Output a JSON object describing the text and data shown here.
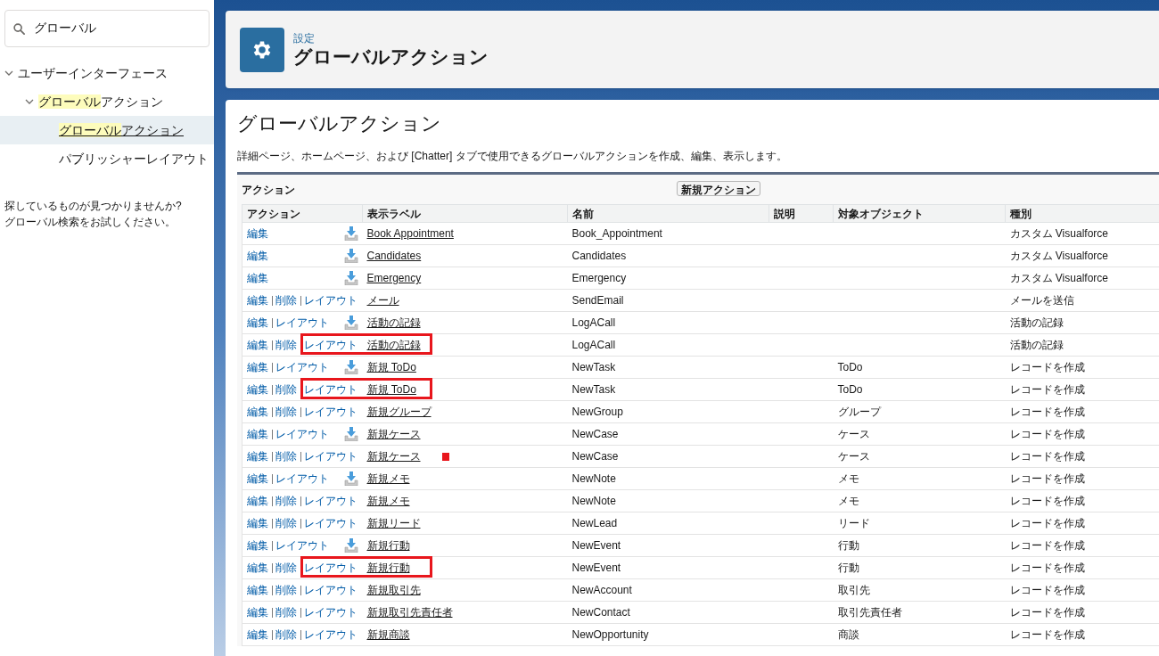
{
  "sidebar": {
    "search": {
      "value": "グローバル"
    },
    "tree": [
      {
        "label_parts": [
          {
            "text": "ユーザーインターフェース",
            "highlighted": false
          }
        ],
        "expanded": true,
        "selected": false,
        "children": [
          {
            "label_parts": [
              {
                "text": "グローバル",
                "highlighted": true
              },
              {
                "text": "アクション",
                "highlighted": false
              }
            ],
            "expanded": true,
            "selected": false,
            "children": [
              {
                "label_parts": [
                  {
                    "text": "グローバル",
                    "highlighted": true
                  },
                  {
                    "text": "アクション",
                    "highlighted": false
                  }
                ],
                "selected": true
              },
              {
                "label_parts": [
                  {
                    "text": "パブリッシャーレイアウト",
                    "highlighted": false
                  }
                ],
                "selected": false
              }
            ]
          }
        ]
      }
    ],
    "hint": [
      "探しているものが見つかりませんか?",
      "グローバル検索をお試しください。"
    ]
  },
  "header": {
    "breadcrumb": "設定",
    "title": "グローバルアクション"
  },
  "page": {
    "title": "グローバルアクション",
    "description": "詳細ページ、ホームページ、および [Chatter] タブで使用できるグローバルアクションを作成、編集、表示します。",
    "section": {
      "title": "アクション",
      "button": "新規アクション"
    },
    "table": {
      "columns": [
        "アクション",
        "表示ラベル",
        "名前",
        "説明",
        "対象オブジェクト",
        "種別"
      ],
      "rows": [
        {
          "actions": [
            "編集"
          ],
          "icon": true,
          "label": "Book Appointment",
          "name": "Book_Appointment",
          "object": "",
          "type": "カスタム Visualforce",
          "boxed": false,
          "marked": false
        },
        {
          "actions": [
            "編集"
          ],
          "icon": true,
          "label": "Candidates",
          "name": "Candidates",
          "object": "",
          "type": "カスタム Visualforce",
          "boxed": false,
          "marked": false
        },
        {
          "actions": [
            "編集"
          ],
          "icon": true,
          "label": "Emergency",
          "name": "Emergency",
          "object": "",
          "type": "カスタム Visualforce",
          "boxed": false,
          "marked": false
        },
        {
          "actions": [
            "編集",
            "削除",
            "レイアウト"
          ],
          "icon": false,
          "label": "メール",
          "name": "SendEmail",
          "object": "",
          "type": "メールを送信",
          "boxed": false,
          "marked": false
        },
        {
          "actions": [
            "編集",
            "レイアウト"
          ],
          "icon": true,
          "label": "活動の記録",
          "name": "LogACall",
          "object": "",
          "type": "活動の記録",
          "boxed": false,
          "marked": false
        },
        {
          "actions": [
            "編集",
            "削除",
            "レイアウト"
          ],
          "icon": false,
          "label": "活動の記録",
          "name": "LogACall",
          "object": "",
          "type": "活動の記録",
          "boxed": true,
          "marked": false
        },
        {
          "actions": [
            "編集",
            "レイアウト"
          ],
          "icon": true,
          "label": "新規 ToDo",
          "name": "NewTask",
          "object": "ToDo",
          "type": "レコードを作成",
          "boxed": false,
          "marked": false
        },
        {
          "actions": [
            "編集",
            "削除",
            "レイアウト"
          ],
          "icon": false,
          "label": "新規 ToDo",
          "name": "NewTask",
          "object": "ToDo",
          "type": "レコードを作成",
          "boxed": true,
          "marked": false
        },
        {
          "actions": [
            "編集",
            "削除",
            "レイアウト"
          ],
          "icon": false,
          "label": "新規グループ",
          "name": "NewGroup",
          "object": "グループ",
          "type": "レコードを作成",
          "boxed": false,
          "marked": false
        },
        {
          "actions": [
            "編集",
            "レイアウト"
          ],
          "icon": true,
          "label": "新規ケース",
          "name": "NewCase",
          "object": "ケース",
          "type": "レコードを作成",
          "boxed": false,
          "marked": false
        },
        {
          "actions": [
            "編集",
            "削除",
            "レイアウト"
          ],
          "icon": false,
          "label": "新規ケース",
          "name": "NewCase",
          "object": "ケース",
          "type": "レコードを作成",
          "boxed": false,
          "marked": true
        },
        {
          "actions": [
            "編集",
            "レイアウト"
          ],
          "icon": true,
          "label": "新規メモ",
          "name": "NewNote",
          "object": "メモ",
          "type": "レコードを作成",
          "boxed": false,
          "marked": false
        },
        {
          "actions": [
            "編集",
            "削除",
            "レイアウト"
          ],
          "icon": false,
          "label": "新規メモ",
          "name": "NewNote",
          "object": "メモ",
          "type": "レコードを作成",
          "boxed": false,
          "marked": false
        },
        {
          "actions": [
            "編集",
            "削除",
            "レイアウト"
          ],
          "icon": false,
          "label": "新規リード",
          "name": "NewLead",
          "object": "リード",
          "type": "レコードを作成",
          "boxed": false,
          "marked": false
        },
        {
          "actions": [
            "編集",
            "レイアウト"
          ],
          "icon": true,
          "label": "新規行動",
          "name": "NewEvent",
          "object": "行動",
          "type": "レコードを作成",
          "boxed": false,
          "marked": false
        },
        {
          "actions": [
            "編集",
            "削除",
            "レイアウト"
          ],
          "icon": false,
          "label": "新規行動",
          "name": "NewEvent",
          "object": "行動",
          "type": "レコードを作成",
          "boxed": true,
          "marked": false
        },
        {
          "actions": [
            "編集",
            "削除",
            "レイアウト"
          ],
          "icon": false,
          "label": "新規取引先",
          "name": "NewAccount",
          "object": "取引先",
          "type": "レコードを作成",
          "boxed": false,
          "marked": false
        },
        {
          "actions": [
            "編集",
            "削除",
            "レイアウト"
          ],
          "icon": false,
          "label": "新規取引先責任者",
          "name": "NewContact",
          "object": "取引先責任者",
          "type": "レコードを作成",
          "boxed": false,
          "marked": false
        },
        {
          "actions": [
            "編集",
            "削除",
            "レイアウト"
          ],
          "icon": false,
          "label": "新規商談",
          "name": "NewOpportunity",
          "object": "商談",
          "type": "レコードを作成",
          "boxed": false,
          "marked": false
        }
      ]
    }
  }
}
